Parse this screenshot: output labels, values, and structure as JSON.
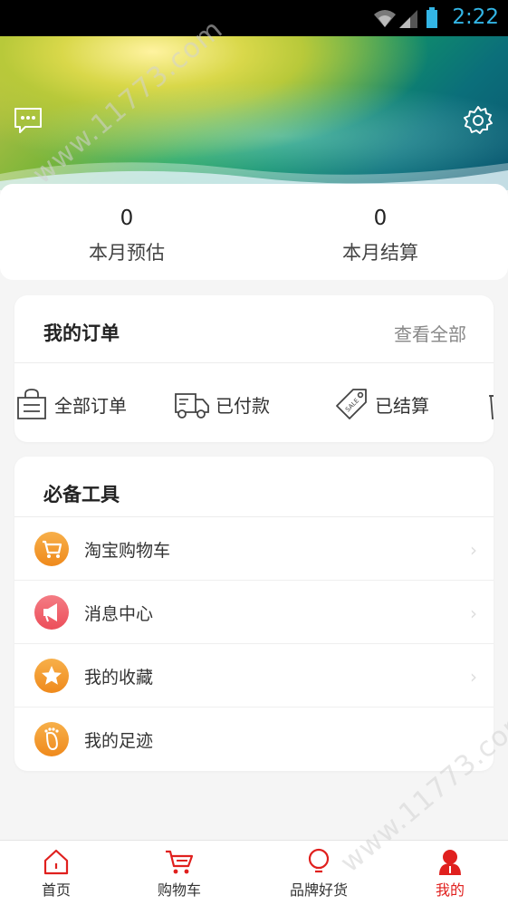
{
  "status_bar": {
    "time": "2:22"
  },
  "header": {
    "message_icon": "message-icon",
    "settings_icon": "gear-icon"
  },
  "stats": [
    {
      "value": "0",
      "label": "本月预估"
    },
    {
      "value": "0",
      "label": "本月结算"
    }
  ],
  "orders": {
    "title": "我的订单",
    "view_all": "查看全部",
    "items": [
      {
        "label": "全部订单",
        "icon": "bag-icon"
      },
      {
        "label": "已付款",
        "icon": "truck-icon"
      },
      {
        "label": "已结算",
        "icon": "sale-tag-icon"
      },
      {
        "label": "",
        "icon": "trash-icon"
      }
    ]
  },
  "tools": {
    "title": "必备工具",
    "items": [
      {
        "label": "淘宝购物车",
        "icon": "cart-icon",
        "color": "#f39a2c"
      },
      {
        "label": "消息中心",
        "icon": "megaphone-icon",
        "color": "#f0606a"
      },
      {
        "label": "我的收藏",
        "icon": "star-icon",
        "color": "#f39a2c"
      },
      {
        "label": "我的足迹",
        "icon": "footprint-icon",
        "color": "#f39a2c"
      }
    ]
  },
  "bottom_nav": [
    {
      "label": "首页",
      "icon": "home-icon",
      "active": false
    },
    {
      "label": "购物车",
      "icon": "cart-icon",
      "active": false
    },
    {
      "label": "品牌好货",
      "icon": "bulb-icon",
      "active": false
    },
    {
      "label": "我的",
      "icon": "user-icon",
      "active": true
    }
  ],
  "watermark": "www.11773.com",
  "colors": {
    "accent": "#e0201e",
    "orange": "#f39a2c",
    "pink": "#f0606a"
  }
}
